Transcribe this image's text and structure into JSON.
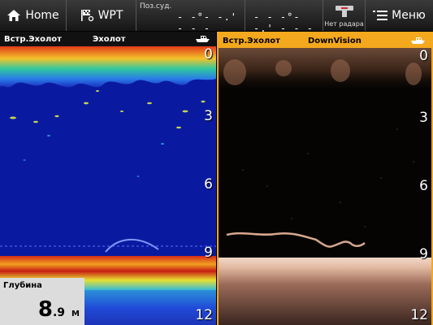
{
  "topbar": {
    "home_label": "Home",
    "wpt_label": "WPT",
    "position_label": "Поз.суд.",
    "latitude": "- -°- -.' - - -",
    "longitude": "- - -°- -.' - - -",
    "radar_status": "Нет радара",
    "menu_label": "Меню"
  },
  "left_panel": {
    "source": "Встр.Эхолот",
    "mode": "Эхолот",
    "depth_ticks": [
      "0",
      "3",
      "6",
      "9",
      "12"
    ],
    "depth_readout": {
      "title": "Глубина",
      "integer": "8",
      "decimal": ".9",
      "unit": "М"
    }
  },
  "right_panel": {
    "source": "Встр.Эхолот",
    "mode": "DownVision",
    "depth_ticks": [
      "0",
      "3",
      "6",
      "9",
      "12"
    ],
    "active": true
  },
  "colors": {
    "accent": "#f3a81d",
    "sonar_bg": "#0a1aa0",
    "downvision_bg": "#050403"
  },
  "icons": [
    "home-icon",
    "waypoint-flag-icon",
    "radar-icon",
    "menu-list-icon",
    "boat-icon"
  ]
}
